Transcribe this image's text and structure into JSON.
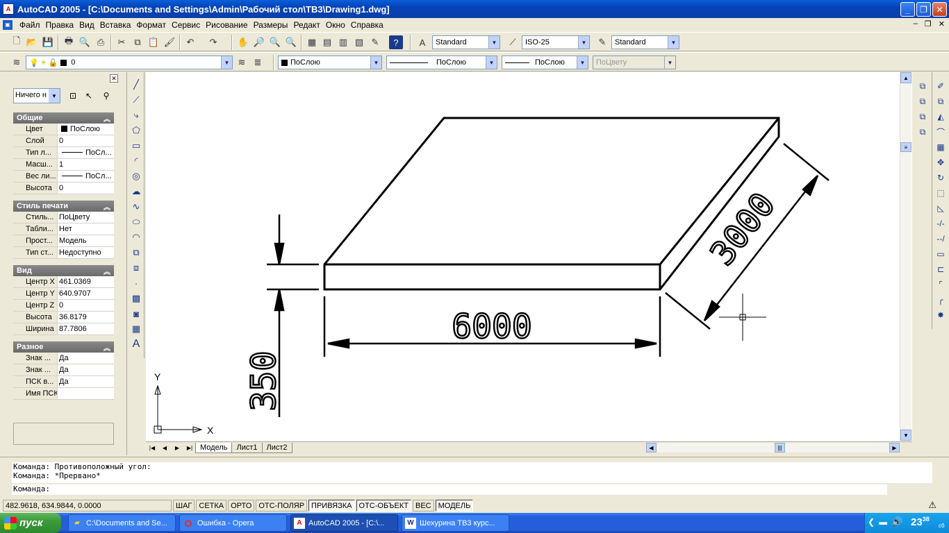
{
  "window": {
    "title": "AutoCAD 2005 - [C:\\Documents and Settings\\Admin\\Рабочий стол\\ТВ3\\Drawing1.dwg]",
    "app_icon": "autocad-icon"
  },
  "menu": [
    "Файл",
    "Правка",
    "Вид",
    "Вставка",
    "Формат",
    "Сервис",
    "Рисование",
    "Размеры",
    "Редакт",
    "Окно",
    "Справка"
  ],
  "toolbar1": {
    "text_style": "Standard",
    "dim_style": "ISO-25",
    "table_style": "Standard"
  },
  "toolbar2": {
    "layer": "0",
    "color": "ПоСлою",
    "linetype": "ПоСлою",
    "lineweight": "ПоСлою",
    "plotstyle": "ПоЦвету"
  },
  "properties": {
    "selection": "Ничего н",
    "sections": [
      {
        "title": "Общие",
        "rows": [
          {
            "k": "Цвет",
            "v": "ПоСлою",
            "swatch": true
          },
          {
            "k": "Слой",
            "v": "0"
          },
          {
            "k": "Тип л...",
            "v": "ПоСл...",
            "line": true
          },
          {
            "k": "Масш...",
            "v": "1"
          },
          {
            "k": "Вес ли...",
            "v": "ПоСл...",
            "line": true
          },
          {
            "k": "Высота",
            "v": "0"
          }
        ]
      },
      {
        "title": "Стиль печати",
        "rows": [
          {
            "k": "Стиль...",
            "v": "ПоЦвету"
          },
          {
            "k": "Табли...",
            "v": "Нет"
          },
          {
            "k": "Прост...",
            "v": "Модель"
          },
          {
            "k": "Тип ст...",
            "v": "Недоступно"
          }
        ]
      },
      {
        "title": "Вид",
        "rows": [
          {
            "k": "Центр X",
            "v": "461.0369"
          },
          {
            "k": "Центр Y",
            "v": "640.9707"
          },
          {
            "k": "Центр Z",
            "v": "0"
          },
          {
            "k": "Высота",
            "v": "36.8179"
          },
          {
            "k": "Ширина",
            "v": "87.7806"
          }
        ]
      },
      {
        "title": "Разное",
        "rows": [
          {
            "k": "Знак ...",
            "v": "Да"
          },
          {
            "k": "Знак ...",
            "v": "Да"
          },
          {
            "k": "ПСК в...",
            "v": "Да"
          },
          {
            "k": "Имя ПСК",
            "v": ""
          }
        ]
      }
    ]
  },
  "drawing": {
    "dim_width": "6000",
    "dim_depth": "3000",
    "dim_height": "350",
    "ucs_x": "X",
    "ucs_y": "Y"
  },
  "tabs": [
    "Модель",
    "Лист1",
    "Лист2"
  ],
  "command": {
    "history": "Команда: Противоположный угол:\nКоманда: *Прервано*",
    "prompt": "Команда:"
  },
  "status": {
    "coords": "482.9618, 634.9844, 0.0000",
    "buttons": [
      {
        "label": "ШАГ",
        "on": false
      },
      {
        "label": "СЕТКА",
        "on": false
      },
      {
        "label": "ОРТО",
        "on": false
      },
      {
        "label": "ОТС-ПОЛЯР",
        "on": false
      },
      {
        "label": "ПРИВЯЗКА",
        "on": true
      },
      {
        "label": "ОТС-ОБЪЕКТ",
        "on": true
      },
      {
        "label": "ВЕС",
        "on": false
      },
      {
        "label": "МОДЕЛЬ",
        "on": true
      }
    ]
  },
  "taskbar": {
    "start": "пуск",
    "tasks": [
      "C:\\Documents and Se...",
      "Ошибка - Opera",
      "AutoCAD 2005 - [C:\\...",
      "Шехурина ТВ3 курс..."
    ],
    "clock": "23",
    "clock_min": "38",
    "day": "сб"
  }
}
